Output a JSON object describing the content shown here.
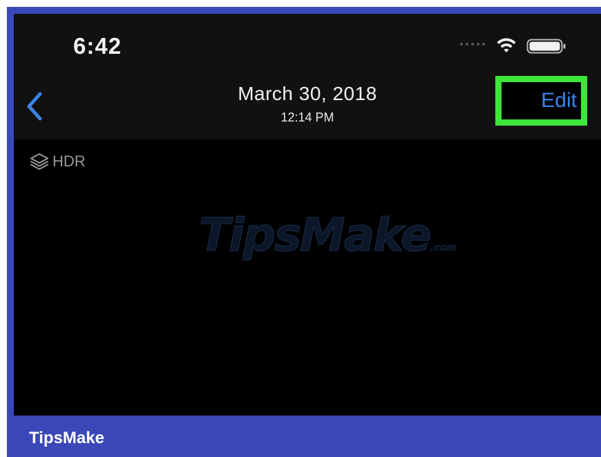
{
  "status_bar": {
    "time": "6:42",
    "icons": [
      "cellular-dots-icon",
      "wifi-icon",
      "battery-icon"
    ]
  },
  "nav_bar": {
    "back_icon": "chevron-left-icon",
    "title_date": "March 30, 2018",
    "title_time": "12:14 PM",
    "edit_label": "Edit"
  },
  "photo": {
    "hdr_icon": "layers-icon",
    "hdr_label": "HDR",
    "watermark": {
      "main": "TipsMake",
      "suffix": ".com"
    }
  },
  "footer": {
    "brand": "TipsMake"
  },
  "colors": {
    "frame_blue": "#3a48b8",
    "accent_blue": "#3b84e6",
    "highlight_green": "#3ee63a",
    "nav_background": "#111111",
    "photo_background": "#000000"
  }
}
